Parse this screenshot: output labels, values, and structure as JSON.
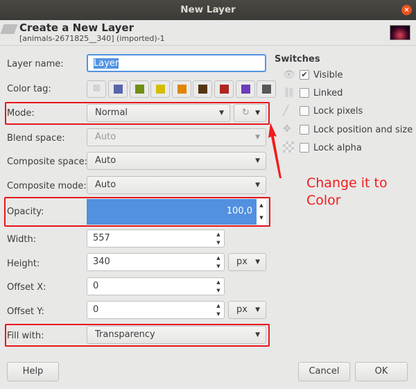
{
  "window": {
    "title": "New Layer",
    "close": "×"
  },
  "header": {
    "title": "Create a New Layer",
    "subtitle": "[animals-2671825__340] (imported)-1"
  },
  "form": {
    "layer_name_label": "Layer name:",
    "layer_name": "Layer",
    "color_tag_label": "Color tag:",
    "color_tags": [
      "#5765ab",
      "#728e14",
      "#d5bc00",
      "#e08600",
      "#553510",
      "#b0281f",
      "#6c3cba",
      "#575757"
    ],
    "mode_label": "Mode:",
    "mode": "Normal",
    "blend_label": "Blend space:",
    "blend": "Auto",
    "composite_space_label": "Composite space:",
    "composite_space": "Auto",
    "composite_mode_label": "Composite mode:",
    "composite_mode": "Auto",
    "opacity_label": "Opacity:",
    "opacity": "100,0",
    "width_label": "Width:",
    "width": "557",
    "height_label": "Height:",
    "height": "340",
    "unit": "px",
    "offx_label": "Offset X:",
    "offx": "0",
    "offy_label": "Offset Y:",
    "offy": "0",
    "unit2": "px",
    "fill_label": "Fill with:",
    "fill": "Transparency"
  },
  "switches": {
    "title": "Switches",
    "items": [
      {
        "label": "Visible",
        "checked": true
      },
      {
        "label": "Linked"
      },
      {
        "label": "Lock pixels"
      },
      {
        "label": "Lock position and size"
      },
      {
        "label": "Lock alpha"
      }
    ]
  },
  "annotation": {
    "line1": "Change it to",
    "line2": "Color"
  },
  "buttons": {
    "help": "Help",
    "cancel": "Cancel",
    "ok": "OK"
  }
}
